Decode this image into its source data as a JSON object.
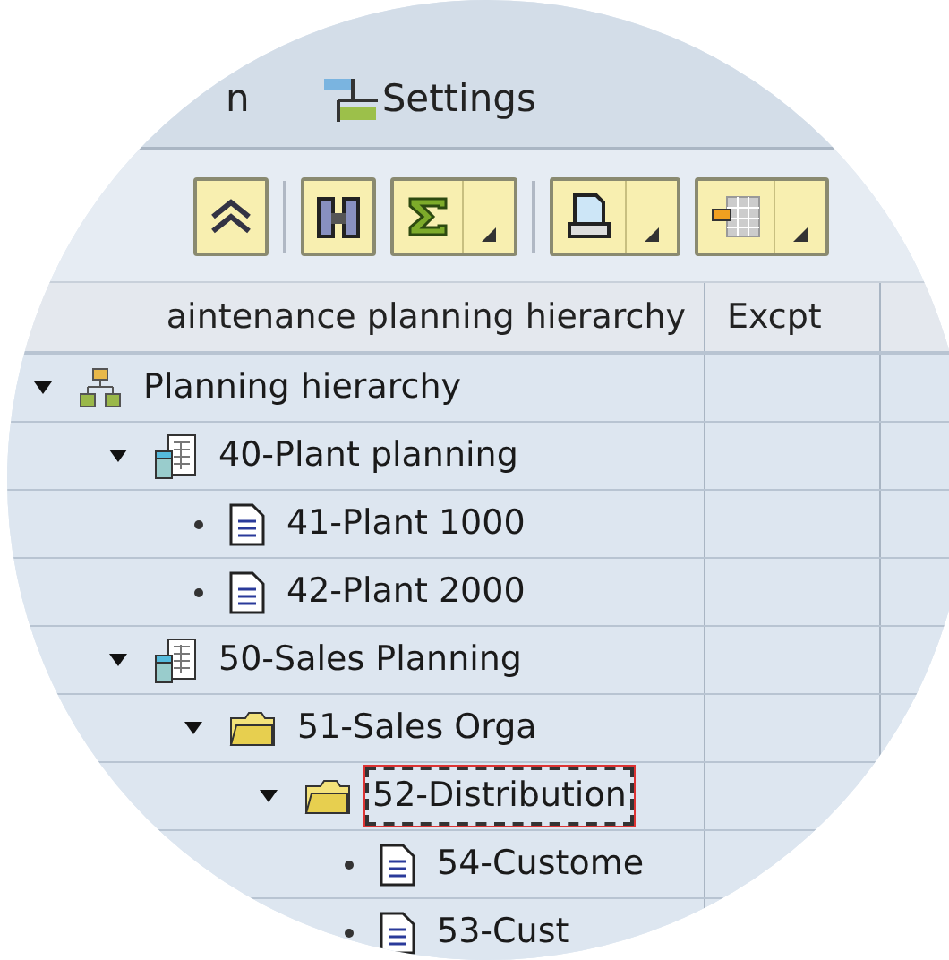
{
  "menu_bar": {
    "items": [
      {
        "label": "n",
        "kind": "plain"
      },
      {
        "label": "Settings",
        "kind": "settings"
      }
    ]
  },
  "toolbar": {
    "buttons": [
      {
        "kind": "collapse",
        "dropdown": false
      },
      {
        "kind": "find",
        "dropdown": false
      },
      {
        "kind": "sum",
        "dropdown": true
      },
      {
        "kind": "print",
        "dropdown": true
      },
      {
        "kind": "layout",
        "dropdown": true
      }
    ]
  },
  "table": {
    "columns": [
      "aintenance planning hierarchy",
      "Excpt"
    ],
    "tree": [
      {
        "label": "Planning hierarchy",
        "kind": "hierarchy",
        "expanded": true,
        "selected": false,
        "children": [
          {
            "label": "40-Plant planning",
            "kind": "plan",
            "expanded": true,
            "selected": false,
            "children": [
              {
                "label": "41-Plant 1000",
                "kind": "doc",
                "selected": false
              },
              {
                "label": "42-Plant 2000",
                "kind": "doc",
                "selected": false
              }
            ]
          },
          {
            "label": "50-Sales Planning",
            "kind": "plan",
            "expanded": true,
            "selected": false,
            "children": [
              {
                "label": "51-Sales Orga",
                "kind": "folder",
                "expanded": true,
                "selected": false,
                "children": [
                  {
                    "label": "52-Distribution",
                    "kind": "folder",
                    "expanded": true,
                    "selected": true,
                    "children": [
                      {
                        "label": "54-Custome",
                        "kind": "doc",
                        "selected": false
                      },
                      {
                        "label": "53-Cust",
                        "kind": "doc",
                        "selected": false
                      }
                    ]
                  }
                ]
              }
            ]
          }
        ]
      }
    ]
  }
}
